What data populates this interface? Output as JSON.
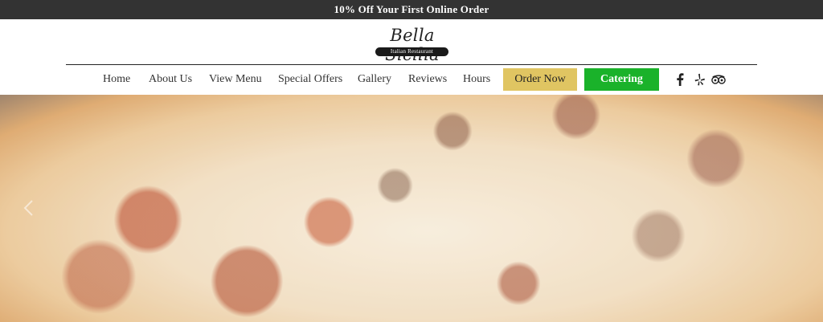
{
  "promo": {
    "text": "10% Off Your First Online Order"
  },
  "logo": {
    "script_text": "Bella Sicilia",
    "pill_text": "Italian Restaurant"
  },
  "nav": {
    "items": [
      {
        "label": "Home"
      },
      {
        "label": "About Us"
      },
      {
        "label": "View Menu"
      },
      {
        "label": "Special Offers"
      },
      {
        "label": "Gallery"
      },
      {
        "label": "Reviews"
      },
      {
        "label": "Hours"
      }
    ],
    "order_button": "Order Now",
    "catering_button": "Catering"
  },
  "social": {
    "icons": [
      "facebook-icon",
      "yelp-icon",
      "tripadvisor-icon"
    ]
  },
  "colors": {
    "promo_bg": "#333333",
    "order_button": "#e0c562",
    "catering_button": "#1ab22a"
  },
  "hero": {
    "image": "pizza"
  }
}
